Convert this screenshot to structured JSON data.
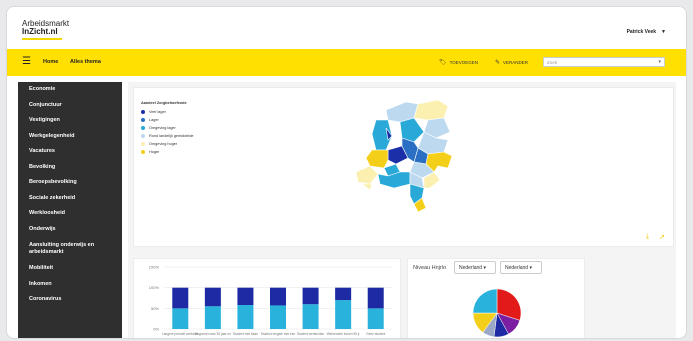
{
  "header": {
    "logo_line1": "Arbeidsmarkt",
    "logo_line2": "InZicht.nl",
    "user_name": "Patrick Veek",
    "user_caret": "▼"
  },
  "navbar": {
    "menu_icon": "☰",
    "home_label": "Home",
    "alles_label": "Alles thema",
    "tool_add_label": "TOEVOEGEN",
    "tool_add_icon": "tag-icon",
    "tool_edit_label": "VERANDER",
    "tool_edit_icon": "pencil-icon",
    "search_placeholder": "Zoek",
    "search_arrow": "▾"
  },
  "sidebar": {
    "items": [
      {
        "label": "Economie"
      },
      {
        "label": "Conjunctuur"
      },
      {
        "label": "Vestigingen"
      },
      {
        "label": "Werkgelegenheid"
      },
      {
        "label": "Vacatures"
      },
      {
        "label": "Bevolking"
      },
      {
        "label": "Beroepsbevolking"
      },
      {
        "label": "Sociale zekerheid"
      },
      {
        "label": "Werkloosheid"
      },
      {
        "label": "Onderwijs"
      },
      {
        "label": "Aansluiting onderwijs en arbeidsmarkt"
      },
      {
        "label": "Mobiliteit"
      },
      {
        "label": "Inkomen"
      },
      {
        "label": "Coronavirus"
      }
    ]
  },
  "map": {
    "legend_title": "Aandeel Zorgbehoefende",
    "legend_items": [
      {
        "label": "Veel lager",
        "color": "#1b2fa8"
      },
      {
        "label": "Lager",
        "color": "#2a6fc4"
      },
      {
        "label": "Omgeving lager",
        "color": "#29a9d8"
      },
      {
        "label": "Rond landelijk gemiddelde",
        "color": "#bcd9ef"
      },
      {
        "label": "Omgeving hoger",
        "color": "#fbf0b0"
      },
      {
        "label": "Hoger",
        "color": "#f4cf1a"
      }
    ],
    "download_icon": "⤓",
    "share_icon": "➚"
  },
  "chart_data": {
    "type": "bar",
    "categories": [
      "Langere periode werkloos",
      "Begonnen aan 35 jaar en",
      "Student met baan",
      "Student enigste met een",
      "Student werkenden",
      "Werkenden boven 55 jr",
      "Geen student"
    ],
    "series": [
      {
        "name": "",
        "color": "#29b3dc",
        "values": [
          50,
          55,
          58,
          57,
          60,
          70,
          50
        ]
      },
      {
        "name": "",
        "color": "#1d2aa3",
        "values": [
          50,
          45,
          42,
          43,
          40,
          30,
          50
        ]
      }
    ],
    "ylim": [
      0,
      100
    ],
    "yticks": [
      "0%",
      "50%",
      "100%",
      "150%"
    ],
    "ytick_values": [
      0,
      50,
      100,
      150
    ]
  },
  "pie": {
    "label": "Niveau Hnjrlo",
    "dropdown1": "Nederland ▾",
    "dropdown2": "Nederland ▾",
    "slices": [
      {
        "value": 30,
        "color": "#e31a1a"
      },
      {
        "value": 12,
        "color": "#7a1fa2"
      },
      {
        "value": 10,
        "color": "#1d2aa3"
      },
      {
        "value": 8,
        "color": "#9aa7c7"
      },
      {
        "value": 15,
        "color": "#f4cf1a"
      },
      {
        "value": 25,
        "color": "#29b3dc"
      }
    ]
  }
}
